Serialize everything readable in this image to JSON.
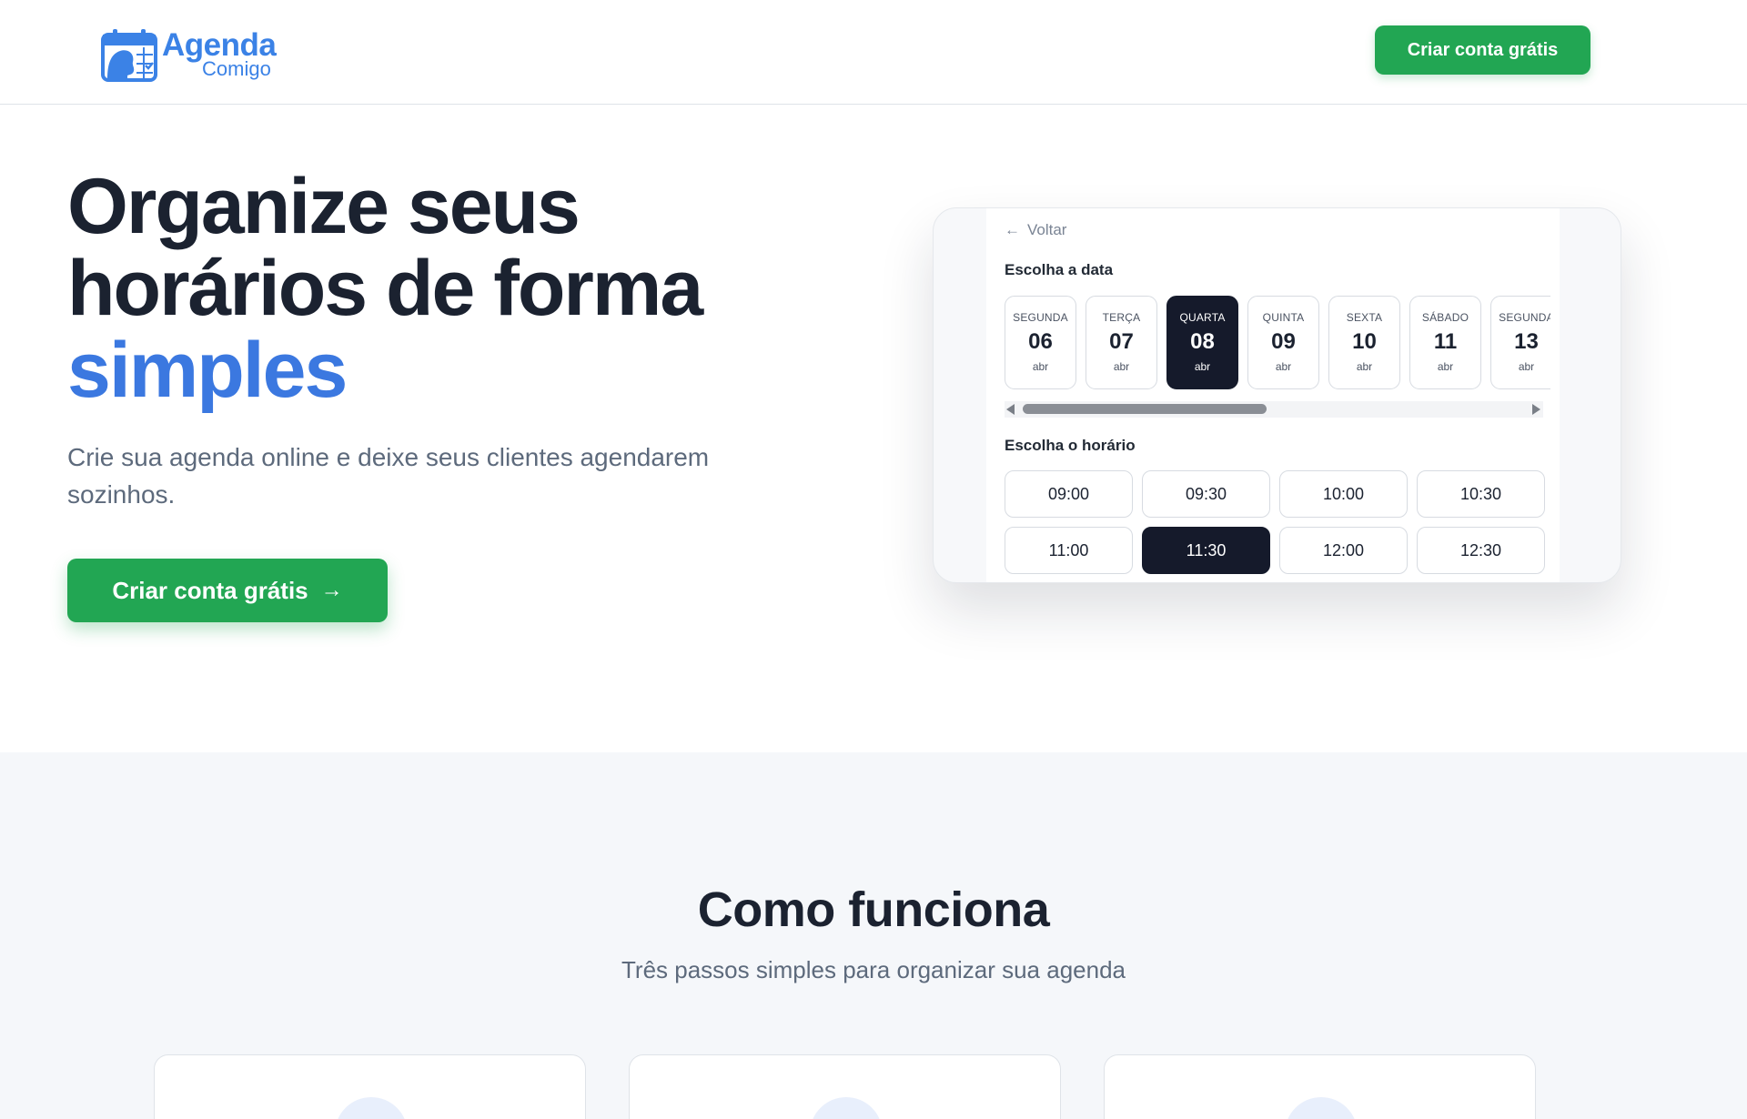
{
  "header": {
    "logo_main": "Agenda",
    "logo_sub": "Comigo",
    "cta_label": "Criar conta grátis"
  },
  "hero": {
    "title_line1": "Organize seus",
    "title_line2": "horários de forma",
    "title_accent": "simples",
    "subtitle": "Crie sua agenda online e deixe seus clientes agendarem sozinhos.",
    "cta_label": "Criar conta grátis",
    "cta_icon": "arrow-right-icon"
  },
  "preview": {
    "back_label": "Voltar",
    "date_label": "Escolha a data",
    "time_label": "Escolha o horário",
    "days": [
      {
        "weekday": "SEGUNDA",
        "day": "06",
        "month": "abr",
        "selected": false
      },
      {
        "weekday": "TERÇA",
        "day": "07",
        "month": "abr",
        "selected": false
      },
      {
        "weekday": "QUARTA",
        "day": "08",
        "month": "abr",
        "selected": true
      },
      {
        "weekday": "QUINTA",
        "day": "09",
        "month": "abr",
        "selected": false
      },
      {
        "weekday": "SEXTA",
        "day": "10",
        "month": "abr",
        "selected": false
      },
      {
        "weekday": "SÁBADO",
        "day": "11",
        "month": "abr",
        "selected": false
      },
      {
        "weekday": "SEGUNDA",
        "day": "13",
        "month": "abr",
        "selected": false
      }
    ],
    "slots": [
      {
        "time": "09:00",
        "selected": false
      },
      {
        "time": "09:30",
        "selected": false
      },
      {
        "time": "10:00",
        "selected": false
      },
      {
        "time": "10:30",
        "selected": false
      },
      {
        "time": "11:00",
        "selected": false
      },
      {
        "time": "11:30",
        "selected": true
      },
      {
        "time": "12:00",
        "selected": false
      },
      {
        "time": "12:30",
        "selected": false
      }
    ],
    "selected_color": "#151a2b"
  },
  "how": {
    "title": "Como funciona",
    "subtitle": "Três passos simples para organizar sua agenda"
  },
  "colors": {
    "brand_blue": "#3b82e6",
    "cta_green": "#22a653",
    "text_dark": "#1b2230",
    "text_muted": "#5d6a7c"
  }
}
